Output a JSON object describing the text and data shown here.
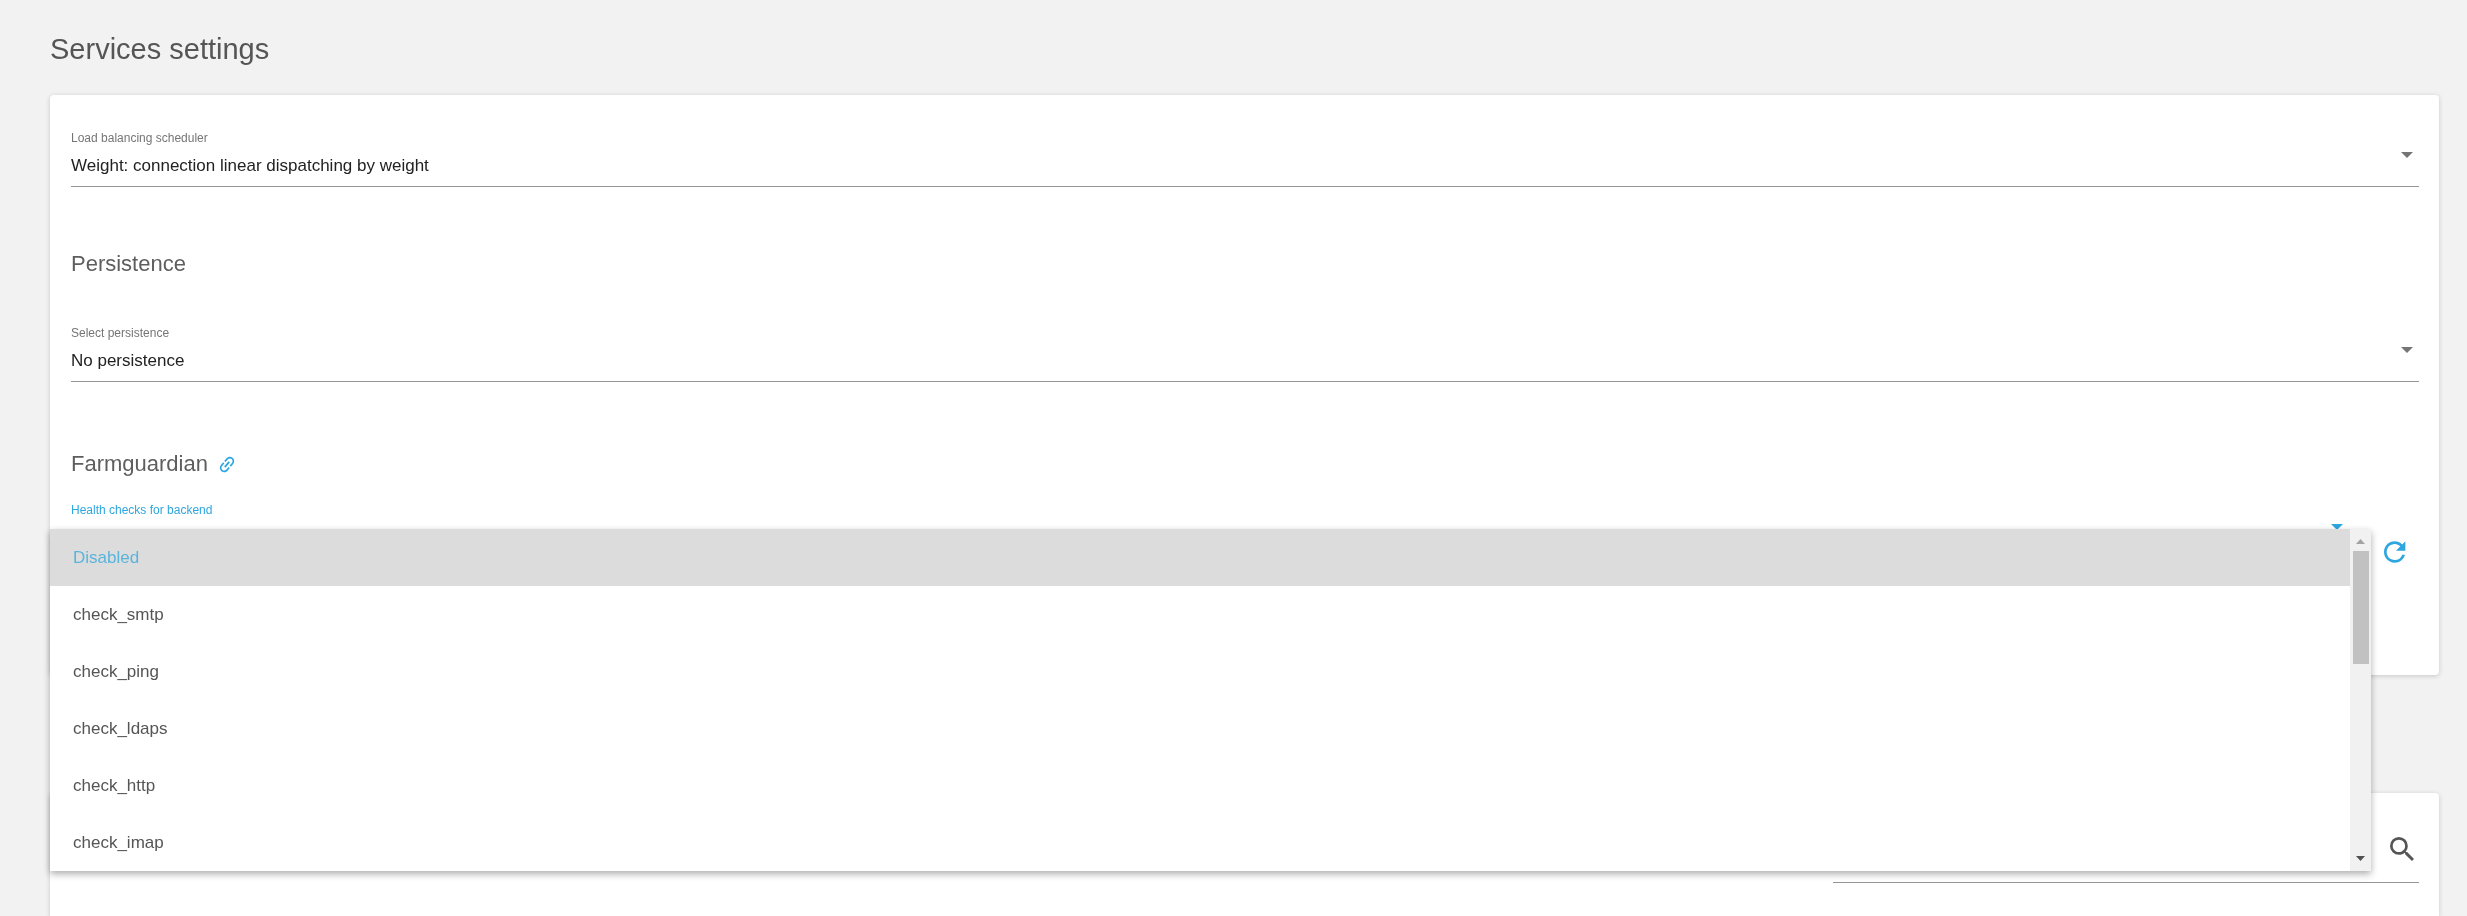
{
  "title": "Services settings",
  "scheduler": {
    "label": "Load balancing scheduler",
    "value": "Weight: connection linear dispatching by weight",
    "focused": false
  },
  "persistence": {
    "heading": "Persistence",
    "field": {
      "label": "Select persistence",
      "value": "No persistence",
      "focused": false
    }
  },
  "farmguardian": {
    "heading": "Farmguardian",
    "field": {
      "label": "Health checks for backend",
      "focused": true
    }
  },
  "health_check_menu": {
    "options": [
      {
        "label": "Disabled",
        "selected": true
      },
      {
        "label": "check_smtp",
        "selected": false
      },
      {
        "label": "check_ping",
        "selected": false
      },
      {
        "label": "check_ldaps",
        "selected": false
      },
      {
        "label": "check_http",
        "selected": false
      },
      {
        "label": "check_imap",
        "selected": false
      }
    ]
  }
}
